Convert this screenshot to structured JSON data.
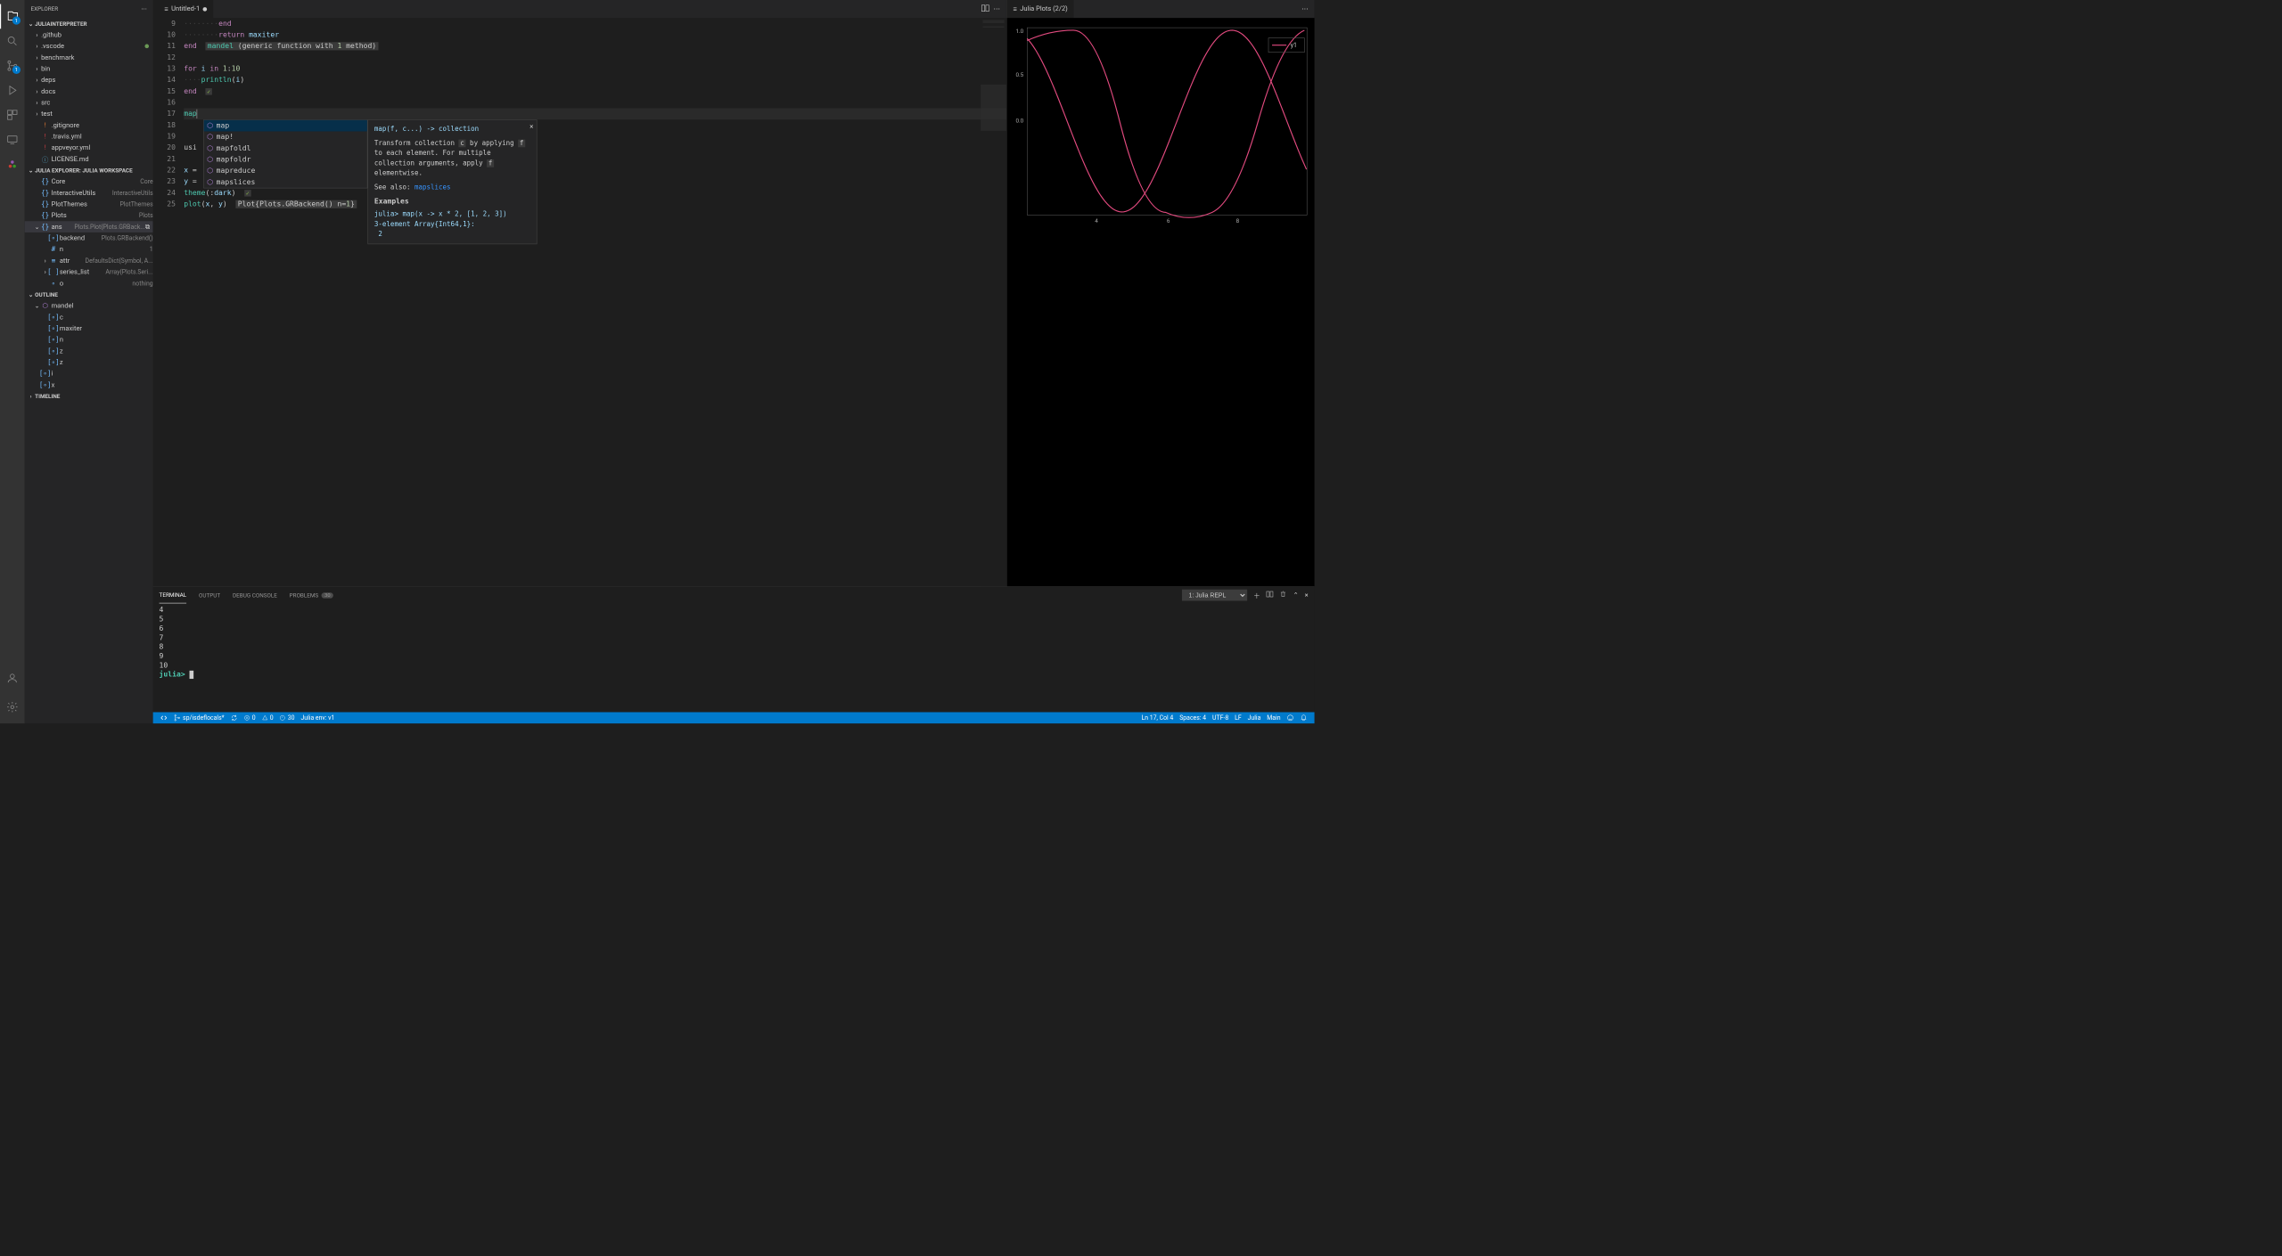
{
  "explorer": {
    "title": "EXPLORER",
    "sections": {
      "project": {
        "title": "JULIAINTERPRETER",
        "items": [
          {
            "label": ".github",
            "type": "folder"
          },
          {
            "label": ".vscode",
            "type": "folder",
            "modified": true
          },
          {
            "label": "benchmark",
            "type": "folder"
          },
          {
            "label": "bin",
            "type": "folder"
          },
          {
            "label": "deps",
            "type": "folder"
          },
          {
            "label": "docs",
            "type": "folder"
          },
          {
            "label": "src",
            "type": "folder"
          },
          {
            "label": "test",
            "type": "folder"
          },
          {
            "label": ".gitignore",
            "type": "file",
            "color": "#e37933"
          },
          {
            "label": ".travis.yml",
            "type": "file",
            "color": "#cc3e44"
          },
          {
            "label": "appveyor.yml",
            "type": "file",
            "color": "#cc3e44"
          },
          {
            "label": "LICENSE.md",
            "type": "file",
            "color": "#519aba"
          }
        ]
      },
      "workspace": {
        "title": "JULIA EXPLORER: JULIA WORKSPACE",
        "items": [
          {
            "label": "Core",
            "desc": "Core",
            "icon": "{}"
          },
          {
            "label": "InteractiveUtils",
            "desc": "InteractiveUtils",
            "icon": "{}"
          },
          {
            "label": "PlotThemes",
            "desc": "PlotThemes",
            "icon": "{}"
          },
          {
            "label": "Plots",
            "desc": "Plots",
            "icon": "{}"
          },
          {
            "label": "ans",
            "desc": "Plots.Plot{Plots.GRBack...",
            "icon": "{}",
            "expanded": true,
            "selected": true,
            "children": [
              {
                "label": "backend",
                "desc": "Plots.GRBackend()",
                "icon": "[∘]"
              },
              {
                "label": "n",
                "desc": "1",
                "icon": "#"
              },
              {
                "label": "attr",
                "desc": "DefaultsDict{Symbol, A...",
                "icon": "≡",
                "expandable": true
              },
              {
                "label": "series_list",
                "desc": "Array{Plots.Seri...",
                "icon": "[ ]",
                "expandable": true
              },
              {
                "label": "o",
                "desc": "nothing",
                "icon": "∘"
              }
            ]
          }
        ]
      },
      "outline": {
        "title": "OUTLINE",
        "items": [
          {
            "label": "mandel",
            "icon": "hex",
            "expanded": true,
            "children": [
              {
                "label": "c",
                "icon": "[∘]"
              },
              {
                "label": "maxiter",
                "icon": "[∘]"
              },
              {
                "label": "n",
                "icon": "[∘]"
              },
              {
                "label": "z",
                "icon": "[∘]"
              },
              {
                "label": "z",
                "icon": "[∘]"
              }
            ]
          },
          {
            "label": "i",
            "icon": "[∘]"
          },
          {
            "label": "x",
            "icon": "[∘]"
          }
        ]
      },
      "timeline": {
        "title": "TIMELINE"
      }
    }
  },
  "activity_badges": {
    "explorer": "1",
    "scm": "1"
  },
  "editor": {
    "tab_label": "Untitled-1",
    "lines": [
      {
        "n": 9,
        "raw": "········end"
      },
      {
        "n": 10,
        "raw": "········return maxiter"
      },
      {
        "n": 11,
        "raw": "end  mandel (generic function with 1 method)",
        "hint": true
      },
      {
        "n": 12,
        "raw": ""
      },
      {
        "n": 13,
        "raw": "for i in 1:10"
      },
      {
        "n": 14,
        "raw": "····println(i)"
      },
      {
        "n": 15,
        "raw": "end  ✓",
        "check": true
      },
      {
        "n": 16,
        "raw": ""
      },
      {
        "n": 17,
        "raw": "map",
        "current": true
      },
      {
        "n": 18,
        "raw": ""
      },
      {
        "n": 19,
        "raw": ""
      },
      {
        "n": 20,
        "raw": "usi"
      },
      {
        "n": 21,
        "raw": ""
      },
      {
        "n": 22,
        "raw": "x ="
      },
      {
        "n": 23,
        "raw": "y ="
      },
      {
        "n": 24,
        "raw": "theme(:dark)  ✓",
        "check": true
      },
      {
        "n": 25,
        "raw": "plot(x, y)  Plot{Plots.GRBackend() n=1}",
        "hint": true
      }
    ],
    "autocomplete": {
      "items": [
        "map",
        "map!",
        "mapfoldl",
        "mapfoldr",
        "mapreduce",
        "mapslices"
      ],
      "selected": 0
    },
    "doc": {
      "signature": "map(f, c...) -> collection",
      "body1": "Transform collection ",
      "code1": "c",
      "body2": " by applying ",
      "code2": "f",
      "body3": " to each element. For multiple collection arguments, apply ",
      "code3": "f",
      "body4": " elementwise.",
      "see_also_label": "See also: ",
      "see_also_link": "mapslices",
      "examples_title": "Examples",
      "example_code": "julia> map(x -> x * 2, [1, 2, 3])\n3-element Array{Int64,1}:\n 2"
    }
  },
  "plot": {
    "tab_label": "Julia Plots (2/2)",
    "legend": "y1",
    "y_ticks": [
      "1.0",
      "0.5",
      "0.0"
    ],
    "x_ticks": [
      "4",
      "6",
      "8"
    ]
  },
  "chart_data": {
    "type": "line",
    "series": [
      {
        "name": "y1",
        "color": "#e24a7f"
      }
    ],
    "x_range": [
      2,
      10
    ],
    "y_range": [
      -1.0,
      1.0
    ],
    "y_ticks_shown": [
      1.0,
      0.5,
      0.0
    ],
    "x_ticks_shown": [
      4,
      6,
      8
    ],
    "function": "sin(x)",
    "title": "",
    "xlabel": "",
    "ylabel": "",
    "theme": "dark"
  },
  "panel": {
    "tabs": {
      "terminal": "TERMINAL",
      "output": "OUTPUT",
      "debug": "DEBUG CONSOLE",
      "problems": "PROBLEMS"
    },
    "problems_count": "30",
    "terminal_select": "1: Julia REPL",
    "terminal_lines": [
      "4",
      "5",
      "6",
      "7",
      "8",
      "9",
      "10",
      ""
    ],
    "prompt": "julia> "
  },
  "statusbar": {
    "branch": "sp/isdeflocals*",
    "errors": "0",
    "warnings": "0",
    "problems": "30",
    "env": "Julia env: v1",
    "position": "Ln 17, Col 4",
    "spaces": "Spaces: 4",
    "encoding": "UTF-8",
    "eol": "LF",
    "language": "Julia",
    "mode": "Main"
  }
}
